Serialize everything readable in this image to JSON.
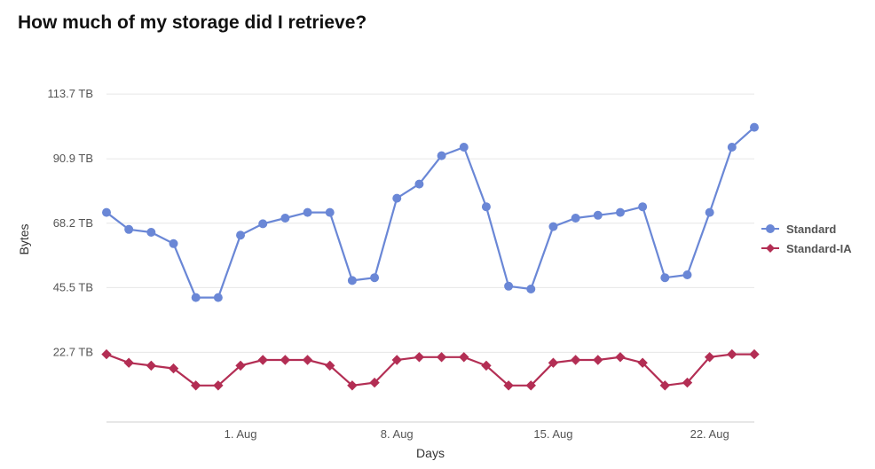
{
  "title": "How much of my storage did I retrieve?",
  "chart_data": {
    "type": "line",
    "xlabel": "Days",
    "ylabel": "Bytes",
    "y_ticks": [
      {
        "value": 22.7,
        "label": "22.7 TB"
      },
      {
        "value": 45.5,
        "label": "45.5 TB"
      },
      {
        "value": 68.2,
        "label": "68.2 TB"
      },
      {
        "value": 90.9,
        "label": "90.9 TB"
      },
      {
        "value": 113.7,
        "label": "113.7 TB"
      }
    ],
    "x_ticks": [
      {
        "index": 6,
        "label": "1. Aug"
      },
      {
        "index": 13,
        "label": "8. Aug"
      },
      {
        "index": 20,
        "label": "15. Aug"
      },
      {
        "index": 27,
        "label": "22. Aug"
      }
    ],
    "ylim": [
      0,
      125
    ],
    "x_count": 30,
    "series": [
      {
        "name": "Standard",
        "color": "#6a87d6",
        "marker": "circle",
        "values": [
          72,
          66,
          65,
          61,
          42,
          42,
          64,
          68,
          70,
          72,
          72,
          48,
          49,
          77,
          82,
          92,
          95,
          74,
          46,
          45,
          67,
          70,
          71,
          72,
          74,
          49,
          50,
          72,
          95,
          102
        ]
      },
      {
        "name": "Standard-IA",
        "color": "#b32e54",
        "marker": "diamond",
        "values": [
          22,
          19,
          18,
          17,
          11,
          11,
          18,
          20,
          20,
          20,
          18,
          11,
          12,
          20,
          21,
          21,
          21,
          18,
          11,
          11,
          19,
          20,
          20,
          21,
          19,
          11,
          12,
          21,
          22,
          22
        ]
      }
    ]
  }
}
